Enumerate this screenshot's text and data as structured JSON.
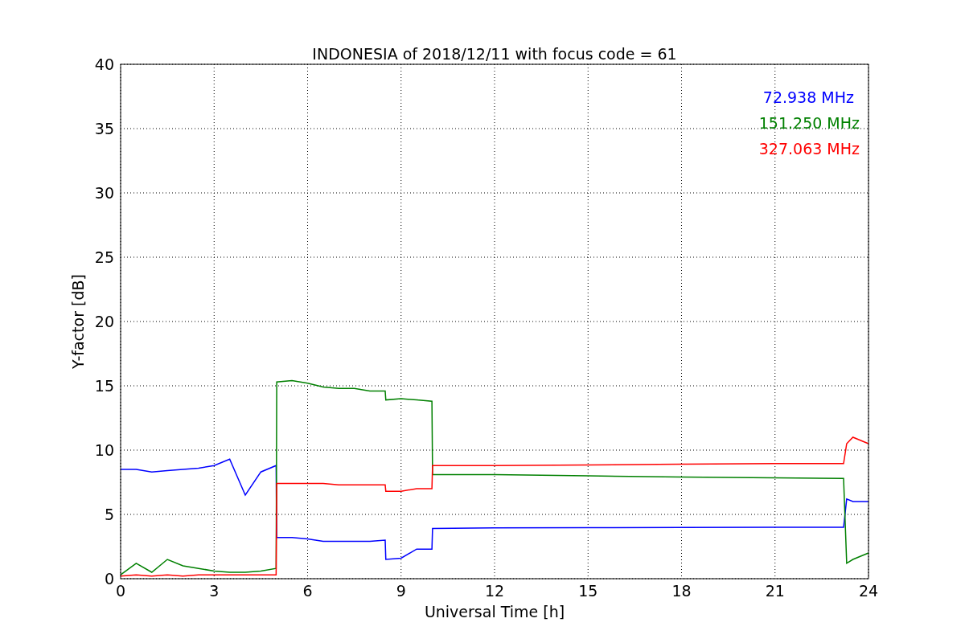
{
  "figure": {
    "chart_data": {
      "type": "line",
      "title": "INDONESIA of 2018/12/11 with focus code = 61",
      "xlabel": "Universal Time [h]",
      "ylabel": "Y-factor [dB]",
      "grid": true,
      "xlim": [
        0,
        24
      ],
      "ylim": [
        0,
        40
      ],
      "xticks": [
        0,
        3,
        6,
        9,
        12,
        15,
        18,
        21,
        24
      ],
      "yticks": [
        0,
        5,
        10,
        15,
        20,
        25,
        30,
        35,
        40
      ],
      "x": [
        0,
        0.5,
        1,
        1.5,
        2,
        2.5,
        3,
        3.5,
        4,
        4.5,
        4.99,
        5.01,
        5.5,
        6,
        6.5,
        7,
        7.5,
        8,
        8.49,
        8.51,
        9,
        9.5,
        9.99,
        10.01,
        12,
        15,
        18,
        21,
        23.2,
        23.3,
        23.5,
        24
      ],
      "series": [
        {
          "name": "72.938 MHz",
          "color": "#0000ff",
          "values": [
            8.5,
            8.5,
            8.3,
            8.4,
            8.5,
            8.6,
            8.8,
            9.3,
            6.5,
            8.3,
            8.8,
            3.2,
            3.2,
            3.1,
            2.9,
            2.9,
            2.9,
            2.9,
            3.0,
            1.5,
            1.6,
            2.3,
            2.3,
            3.9,
            3.95,
            3.97,
            3.98,
            4.0,
            4.0,
            6.2,
            6.0,
            6.0
          ]
        },
        {
          "name": "151.250 MHz",
          "color": "#008000",
          "values": [
            0.3,
            1.2,
            0.5,
            1.5,
            1.0,
            0.8,
            0.6,
            0.5,
            0.5,
            0.6,
            0.8,
            15.3,
            15.4,
            15.2,
            14.9,
            14.8,
            14.8,
            14.6,
            14.6,
            13.9,
            14.0,
            13.9,
            13.8,
            8.1,
            8.1,
            8.0,
            7.9,
            7.85,
            7.8,
            1.2,
            1.5,
            2.0
          ]
        },
        {
          "name": "327.063 MHz",
          "color": "#ff0000",
          "values": [
            0.2,
            0.3,
            0.2,
            0.3,
            0.2,
            0.3,
            0.3,
            0.3,
            0.3,
            0.3,
            0.3,
            7.4,
            7.4,
            7.4,
            7.4,
            7.3,
            7.3,
            7.3,
            7.3,
            6.8,
            6.8,
            7.0,
            7.0,
            8.8,
            8.8,
            8.85,
            8.9,
            8.95,
            8.95,
            10.5,
            11,
            10.5
          ]
        }
      ]
    }
  }
}
